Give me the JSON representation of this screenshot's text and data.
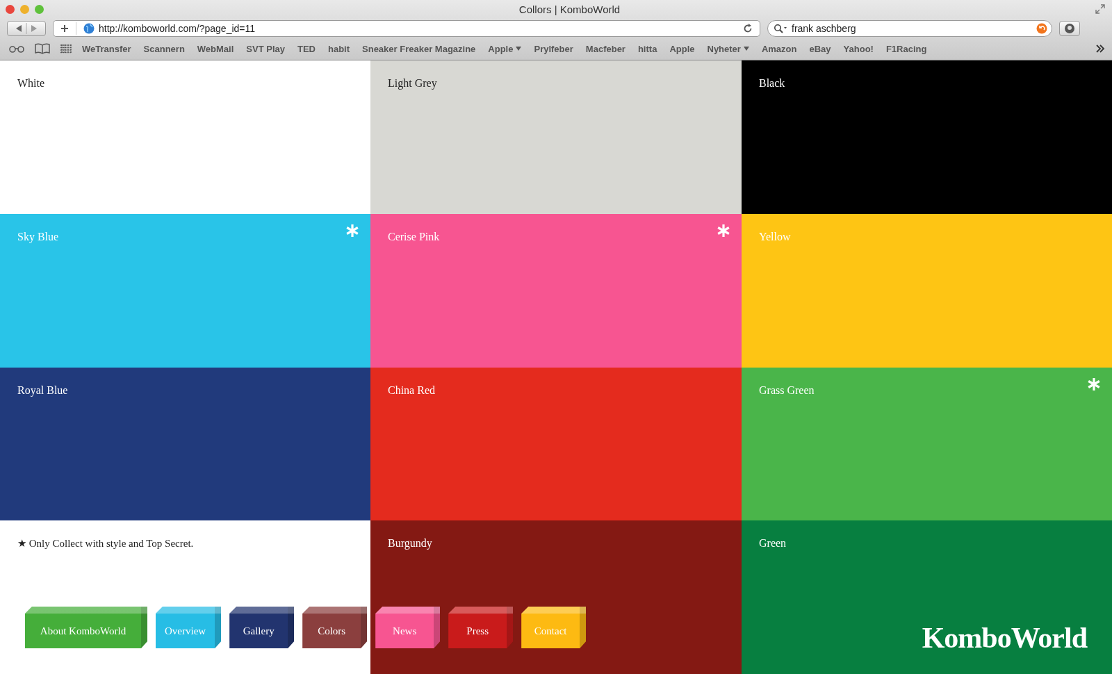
{
  "window": {
    "title": "Collors | KomboWorld"
  },
  "toolbar": {
    "url": "http://komboworld.com/?page_id=11",
    "search": {
      "value": "frank aschberg"
    }
  },
  "bookmarks": [
    {
      "label": "WeTransfer",
      "menu": false
    },
    {
      "label": "Scannern",
      "menu": false
    },
    {
      "label": "WebMail",
      "menu": false
    },
    {
      "label": "SVT Play",
      "menu": false
    },
    {
      "label": "TED",
      "menu": false
    },
    {
      "label": "habit",
      "menu": false
    },
    {
      "label": "Sneaker Freaker Magazine",
      "menu": false
    },
    {
      "label": "Apple",
      "menu": true
    },
    {
      "label": "Prylfeber",
      "menu": false
    },
    {
      "label": "Macfeber",
      "menu": false
    },
    {
      "label": "hitta",
      "menu": false
    },
    {
      "label": "Apple",
      "menu": false
    },
    {
      "label": "Nyheter",
      "menu": true
    },
    {
      "label": "Amazon",
      "menu": false
    },
    {
      "label": "eBay",
      "menu": false
    },
    {
      "label": "Yahoo!",
      "menu": false
    },
    {
      "label": "F1Racing",
      "menu": false
    }
  ],
  "swatches": [
    {
      "name": "White",
      "color": "#ffffff",
      "starred": false
    },
    {
      "name": "Light Grey",
      "color": "#d8d8d3",
      "starred": false
    },
    {
      "name": "Black",
      "color": "#000000",
      "starred": false
    },
    {
      "name": "Sky Blue",
      "color": "#29c4e8",
      "starred": true
    },
    {
      "name": "Cerise Pink",
      "color": "#f75591",
      "starred": true
    },
    {
      "name": "Yellow",
      "color": "#fec514",
      "starred": false
    },
    {
      "name": "Royal Blue",
      "color": "#213a7c",
      "starred": false
    },
    {
      "name": "China Red",
      "color": "#e42b1e",
      "starred": false
    },
    {
      "name": "Grass Green",
      "color": "#4ab54a",
      "starred": true
    },
    {
      "kind": "note",
      "text": "★ Only Collect with style and Top Secret."
    },
    {
      "name": "Burgundy",
      "color": "#841913",
      "starred": false
    },
    {
      "name": "Green",
      "color": "#077f40",
      "starred": false,
      "logo": "KomboWorld"
    }
  ],
  "nav": [
    {
      "label": "About KomboWorld",
      "color": "#45ae3a"
    },
    {
      "label": "Overview",
      "color": "#27bde5"
    },
    {
      "label": "Gallery",
      "color": "#22346f"
    },
    {
      "label": "Colors",
      "color": "#8b3f3e"
    },
    {
      "label": "News",
      "color": "#f75591"
    },
    {
      "label": "Press",
      "color": "#c91b1b"
    },
    {
      "label": "Contact",
      "color": "#fdba12"
    }
  ]
}
